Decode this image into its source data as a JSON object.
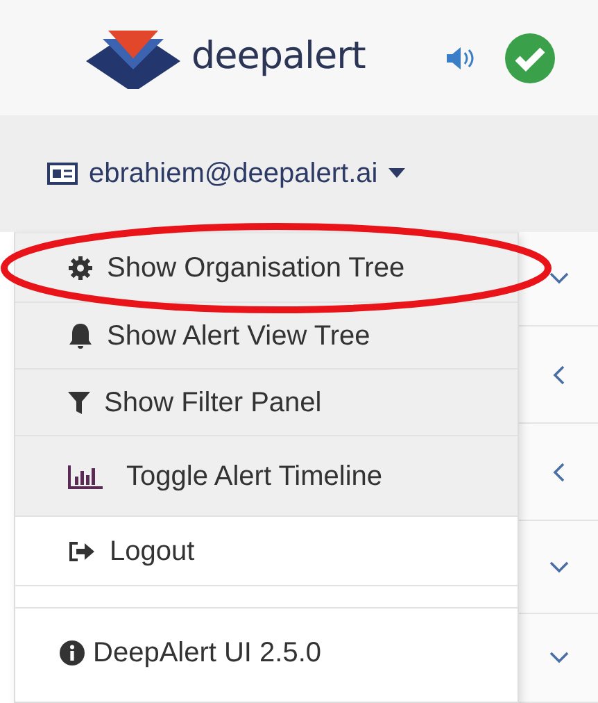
{
  "header": {
    "logo_text": "deepalert",
    "status_ok": true
  },
  "user_menu": {
    "email": "ebrahiem@deepalert.ai",
    "expanded": true
  },
  "menu_items": [
    {
      "label": "Show Organisation Tree",
      "shaded": true,
      "circled": true
    },
    {
      "label": "Show Alert View Tree",
      "shaded": true,
      "circled": false
    },
    {
      "label": "Show Filter Panel",
      "shaded": true,
      "circled": false
    },
    {
      "label": "Toggle Alert Timeline",
      "shaded": true,
      "circled": false
    },
    {
      "label": "Logout",
      "shaded": false,
      "circled": false
    }
  ],
  "version": "DeepAlert UI 2.5.0",
  "side_rows": [
    {
      "expanded": true
    },
    {
      "expanded": false
    },
    {
      "expanded": false
    },
    {
      "expanded": true
    },
    {
      "expanded": true
    }
  ]
}
